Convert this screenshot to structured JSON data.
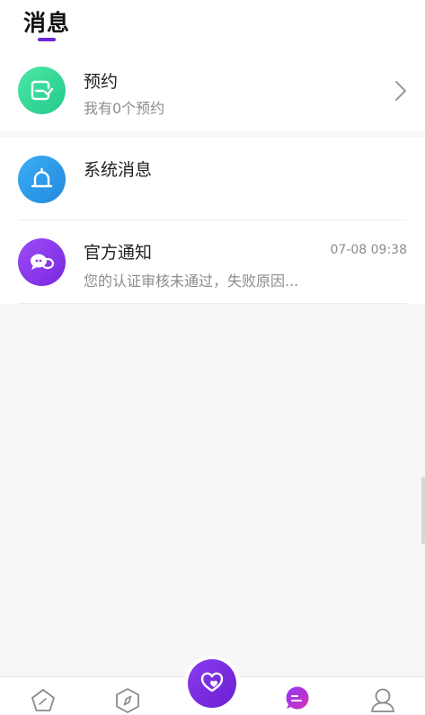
{
  "header": {
    "title": "消息"
  },
  "appointment": {
    "title": "预约",
    "subtitle": "我有0个预约",
    "icon": "calendar-check-icon",
    "color": "#3ddc97"
  },
  "messages": [
    {
      "title": "系统消息",
      "subtitle": "",
      "time": "",
      "icon": "bell-icon",
      "color": "#2e9be8"
    },
    {
      "title": "官方通知",
      "subtitle": "您的认证审核未通过，失败原因...",
      "time": "07-08 09:38",
      "icon": "chat-bubbles-icon",
      "color": "#8b3cf0"
    }
  ],
  "tabbar": {
    "tabs": [
      {
        "name": "home",
        "icon": "pentagon-home-icon",
        "active": false
      },
      {
        "name": "discover",
        "icon": "compass-icon",
        "active": false
      },
      {
        "name": "match",
        "icon": "heart-center-icon",
        "active": false
      },
      {
        "name": "messages",
        "icon": "message-bubble-icon",
        "active": true
      },
      {
        "name": "profile",
        "icon": "user-icon",
        "active": false
      }
    ],
    "accent": "#7b2ee6"
  }
}
